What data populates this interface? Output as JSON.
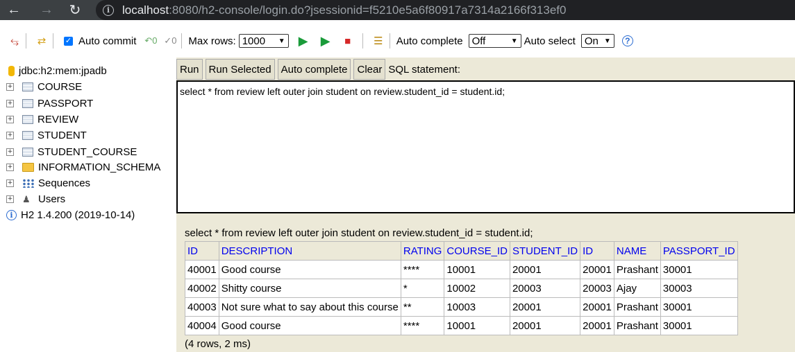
{
  "browser": {
    "url_host": "localhost",
    "url_rest": ":8080/h2-console/login.do?jsessionid=f5210e5a6f80917a7314a2166f313ef0"
  },
  "toolbar": {
    "auto_commit_label": "Auto commit",
    "max_rows_label": "Max rows:",
    "max_rows_value": "1000",
    "auto_complete_label": "Auto complete",
    "auto_complete_value": "Off",
    "auto_select_label": "Auto select",
    "auto_select_value": "On"
  },
  "sidebar": {
    "db": "jdbc:h2:mem:jpadb",
    "items": [
      {
        "label": "COURSE",
        "icon": "table-icon"
      },
      {
        "label": "PASSPORT",
        "icon": "table-icon"
      },
      {
        "label": "REVIEW",
        "icon": "table-icon"
      },
      {
        "label": "STUDENT",
        "icon": "table-icon"
      },
      {
        "label": "STUDENT_COURSE",
        "icon": "table-icon"
      },
      {
        "label": "INFORMATION_SCHEMA",
        "icon": "folder-icon"
      },
      {
        "label": "Sequences",
        "icon": "sequences-icon"
      },
      {
        "label": "Users",
        "icon": "users-icon"
      }
    ],
    "version": "H2 1.4.200 (2019-10-14)"
  },
  "main": {
    "buttons": {
      "run": "Run",
      "run_selected": "Run Selected",
      "auto_complete": "Auto complete",
      "clear": "Clear"
    },
    "sql_label": "SQL statement:",
    "sql": "select * from review left outer join student on review.student_id = student.id;"
  },
  "result": {
    "query": "select * from review left outer join student on review.student_id = student.id;",
    "columns": [
      "ID",
      "DESCRIPTION",
      "RATING",
      "COURSE_ID",
      "STUDENT_ID",
      "ID",
      "NAME",
      "PASSPORT_ID"
    ],
    "rows": [
      [
        "40001",
        "Good course",
        "****",
        "10001",
        "20001",
        "20001",
        "Prashant",
        "30001"
      ],
      [
        "40002",
        "Shitty course",
        "*",
        "10002",
        "20003",
        "20003",
        "Ajay",
        "30003"
      ],
      [
        "40003",
        "Not sure what to say about this course",
        "**",
        "10003",
        "20001",
        "20001",
        "Prashant",
        "30001"
      ],
      [
        "40004",
        "Good course",
        "****",
        "10001",
        "20001",
        "20001",
        "Prashant",
        "30001"
      ]
    ],
    "footer": "(4 rows, 2 ms)"
  },
  "colors": {
    "panel": "#ece9d8",
    "header_link": "#0000ee",
    "browser_bar": "#3c4043"
  }
}
